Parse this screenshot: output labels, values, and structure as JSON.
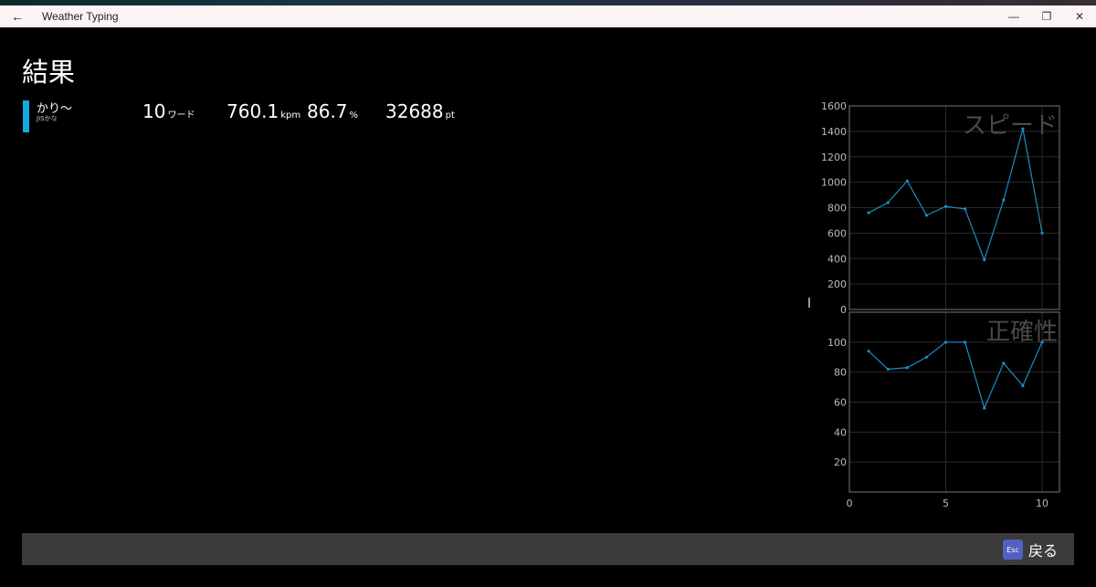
{
  "window": {
    "title": "Weather Typing",
    "controls": {
      "minimize": "—",
      "restore": "❐",
      "close": "✕"
    }
  },
  "page": {
    "title": "結果"
  },
  "course": {
    "name": "かり〜",
    "layout": "JISかな",
    "accent_color": "#15a7e0"
  },
  "stats": {
    "words": {
      "value": "10",
      "unit": "ワード"
    },
    "speed": {
      "value": "760.1",
      "unit": "kpm"
    },
    "accuracy": {
      "value": "86.7",
      "unit": "%"
    },
    "score": {
      "value": "32688",
      "unit": "pt"
    }
  },
  "chart_data": [
    {
      "type": "line",
      "title": "スピード",
      "x": [
        1,
        2,
        3,
        4,
        5,
        6,
        7,
        8,
        9,
        10
      ],
      "values": [
        760,
        840,
        1010,
        740,
        810,
        790,
        390,
        860,
        1420,
        600
      ],
      "ylim": [
        0,
        1600
      ],
      "yticks": [
        0,
        200,
        400,
        600,
        800,
        1000,
        1200,
        1400,
        1600
      ],
      "grid": true,
      "color": "#1e8cc4"
    },
    {
      "type": "line",
      "title": "正確性",
      "x": [
        1,
        2,
        3,
        4,
        5,
        6,
        7,
        8,
        9,
        10
      ],
      "values": [
        94,
        82,
        83,
        90,
        100,
        100,
        56,
        86,
        71,
        100
      ],
      "ylim": [
        0,
        120
      ],
      "yticks": [
        20,
        40,
        60,
        80,
        100
      ],
      "xlim": [
        0,
        10.9
      ],
      "xticks": [
        0,
        5,
        10
      ],
      "grid": true,
      "color": "#1e8cc4"
    }
  ],
  "footer": {
    "key": "Esc",
    "back_label": "戻る"
  }
}
